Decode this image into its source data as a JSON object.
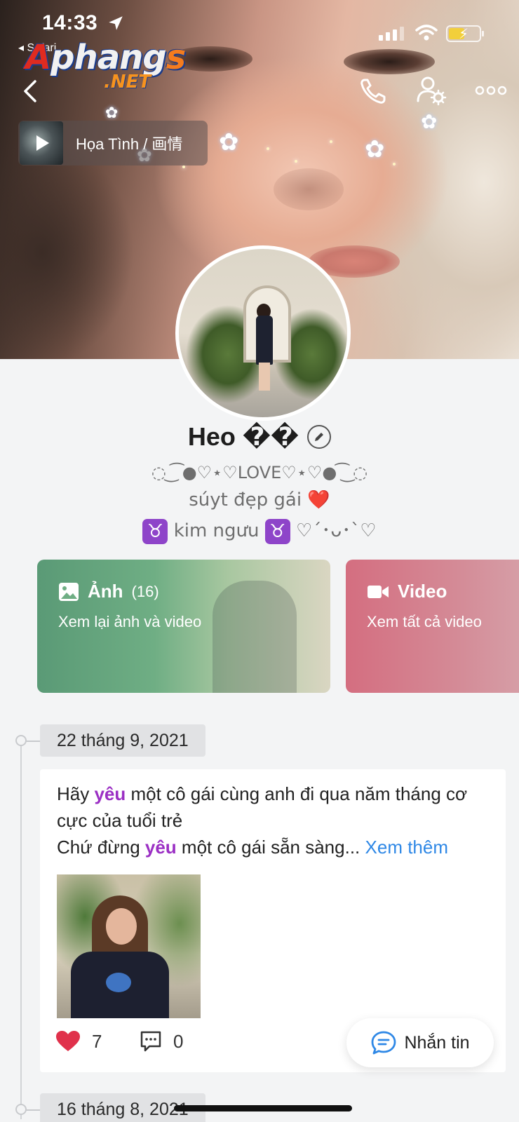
{
  "status_bar": {
    "time": "14:33",
    "back_app": "Safari"
  },
  "watermark": {
    "line1_a": "A",
    "line1_b": "phang",
    "line1_c": "s",
    "line2": ".NET"
  },
  "cover": {
    "music_title": "Họa Tình / 画情"
  },
  "profile": {
    "name": "Heo ��",
    "bio_line1": "◌ ͜ ͡ ●♡⋆♡LOVE♡⋆♡● ͡ ͜ ◌",
    "bio_line2": "súyt đẹp gái",
    "bio_line3_text": "kim ngưu",
    "bio_line3_tail": "♡´･ᴗ･`♡",
    "taurus_symbol": "♉",
    "heart_emoji": "❤️"
  },
  "media": {
    "photos_label": "Ảnh",
    "photos_count": "(16)",
    "photos_sub": "Xem lại ảnh và video",
    "video_label": "Video",
    "video_sub": "Xem tất cả video"
  },
  "timeline": {
    "date1": "22 tháng 9, 2021",
    "date2": "16 tháng 8, 2021",
    "post": {
      "part1": "Hãy ",
      "hl1": "yêu",
      "part2": " một cô gái cùng anh đi qua năm tháng cơ cực của tuổi trẻ",
      "part3": "Chứ đừng ",
      "hl2": "yêu",
      "part4": " một cô gái sẵn sàng...",
      "see_more": "Xem thêm",
      "likes": "7",
      "comments": "0"
    }
  },
  "actions": {
    "message_label": "Nhắn tin"
  },
  "colors": {
    "highlight": "#9b2fc4",
    "link": "#2f88e6",
    "photo_card": "#5a9a76",
    "video_card": "#d46e80",
    "heart": "#e0314b"
  },
  "icons": [
    "back-icon",
    "phone-icon",
    "user-settings-icon",
    "more-icon",
    "play-icon",
    "edit-icon",
    "image-icon",
    "video-camera-icon",
    "heart-icon",
    "comment-icon",
    "chat-icon",
    "location-arrow-icon",
    "wifi-icon",
    "battery-icon"
  ]
}
